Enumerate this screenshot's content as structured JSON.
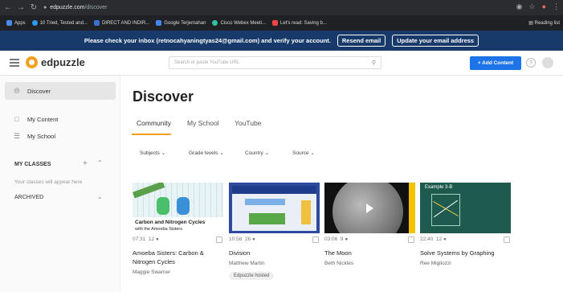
{
  "browser": {
    "url_host": "edpuzzle.com",
    "url_path": "/discover",
    "bookmarks": [
      "Apps",
      "10 Tried, Tested and...",
      "DIRECT AND INDIR...",
      "Google Terjemahan",
      "Cisco Webex Meeti...",
      "Let's read: Saving b..."
    ],
    "reading_list": "Reading list"
  },
  "banner": {
    "message": "Please check your inbox (retnocahyaningtyas24@gmail.com) and verify your account.",
    "resend": "Resend email",
    "update": "Update your email address"
  },
  "header": {
    "logo": "edpuzzle",
    "search_placeholder": "Search or paste YouTube URL",
    "add_content": "+  Add Content",
    "help": "?"
  },
  "sidebar": {
    "discover": "Discover",
    "my_content": "My Content",
    "my_school": "My School",
    "my_classes": "MY CLASSES",
    "empty_classes": "Your classes will appear here",
    "archived": "ARCHIVED"
  },
  "main": {
    "title": "Discover",
    "tabs": [
      "Community",
      "My School",
      "YouTube"
    ],
    "filters": [
      "Subjects",
      "Grade levels",
      "Country",
      "Source"
    ],
    "cards": [
      {
        "duration": "07:31",
        "count": "12",
        "title": "Amoeba Sisters: Carbon & Nitrogen Cycles",
        "author": "Maggie Swarner",
        "chip": ""
      },
      {
        "duration": "10:58",
        "count": "26",
        "title": "Division",
        "author": "Matthew Martin",
        "chip": "Edpuzzle hosted"
      },
      {
        "duration": "03:06",
        "count": "9",
        "title": "The Moon",
        "author": "Beth Nickles",
        "chip": ""
      },
      {
        "duration": "22:40",
        "count": "12",
        "title": "Solve Systems by Graphing",
        "author": "Ree Migliozzi",
        "chip": ""
      }
    ],
    "thumb_texts": [
      "Carbon and Nitrogen Cycles",
      "with the Amoeba Sisters",
      "Example 3-B"
    ]
  }
}
